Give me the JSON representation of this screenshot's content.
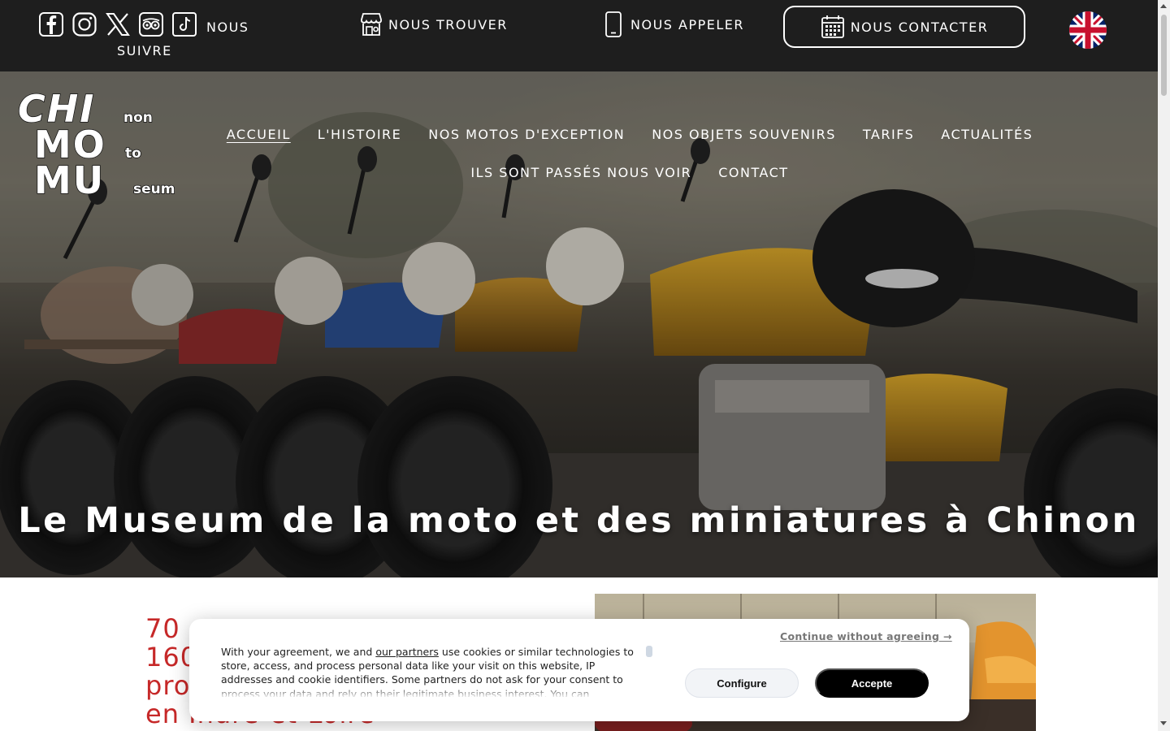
{
  "topbar": {
    "social_icons": [
      "facebook-icon",
      "instagram-icon",
      "x-twitter-icon",
      "tripadvisor-icon",
      "tiktok-icon"
    ],
    "follow_line1": "NOUS",
    "follow_line2": "SUIVRE",
    "find_label": "NOUS TROUVER",
    "call_label": "NOUS APPELER",
    "contact_label": "NOUS CONTACTER",
    "language_icon": "uk-flag-icon"
  },
  "logo": {
    "line1_big": "CHI",
    "line1_small": "non",
    "line2_big": "MO",
    "line2_small": "to",
    "line3_big": "MU",
    "line3_small": "seum"
  },
  "nav": {
    "items": [
      {
        "label": "ACCUEIL",
        "active": true
      },
      {
        "label": "L'HISTOIRE"
      },
      {
        "label": "NOS MOTOS D'EXCEPTION"
      },
      {
        "label": "NOS OBJETS SOUVENIRS"
      },
      {
        "label": "TARIFS"
      },
      {
        "label": "ACTUALITÉS"
      },
      {
        "label": "ILS SONT PASSÉS NOUS VOIR"
      },
      {
        "label": "CONTACT"
      }
    ]
  },
  "hero": {
    "title": "Le Museum de la moto et des miniatures à Chinon"
  },
  "content": {
    "headline_l1": "70",
    "headline_l2": "160",
    "headline_l3": "pro",
    "headline_l4": "en Indre-et-Loire"
  },
  "cookie": {
    "text_before": "With your agreement, we and",
    "partners_link": "our partners",
    "text_after": "use cookies or similar technologies to store, access, and process personal data like your visit on this website, IP addresses and cookie identifiers. Some partners do not ask for your consent to process your data and rely on their legitimate business interest. You can",
    "continue_label": "Continue without agreeing →",
    "configure_label": "Configure",
    "accept_label": "Accepte"
  },
  "colors": {
    "topbar_bg": "#1e1e1e",
    "headline_red": "#c62828",
    "accept_bg": "#000000"
  }
}
